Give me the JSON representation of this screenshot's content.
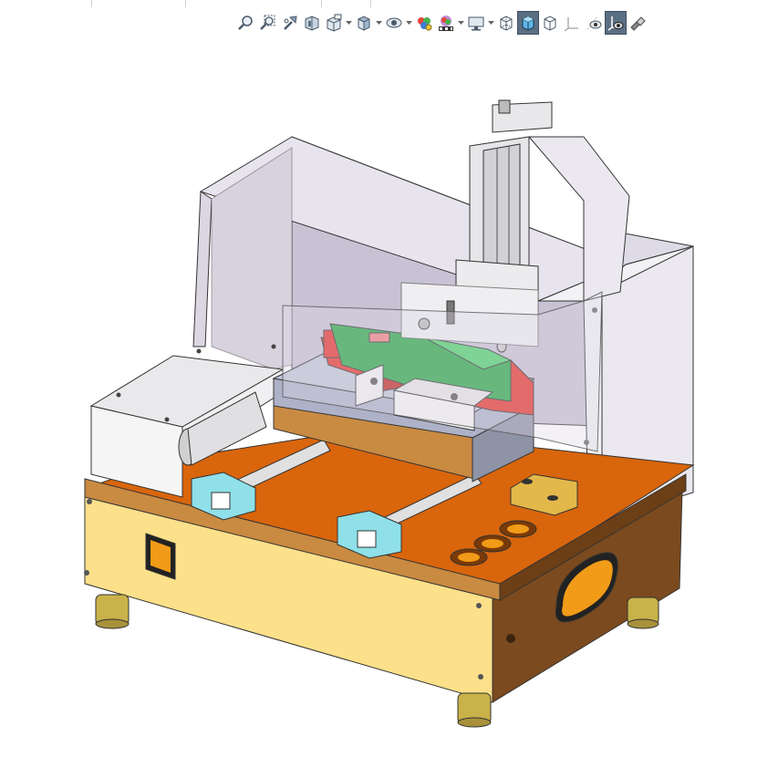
{
  "window": {
    "tabs": [
      "",
      "",
      "",
      ""
    ]
  },
  "toolbar": {
    "buttons": [
      {
        "id": "zoom-to-fit",
        "icon": "zoom-to-fit-icon",
        "dropdown": false
      },
      {
        "id": "zoom-to-area",
        "icon": "zoom-area-icon",
        "dropdown": false
      },
      {
        "id": "previous-view",
        "icon": "previous-view-icon",
        "dropdown": false
      },
      {
        "id": "section-view",
        "icon": "section-view-icon",
        "dropdown": false
      },
      {
        "id": "dynamic-annotation",
        "icon": "dynamic-annotation-icon",
        "dropdown": true
      },
      {
        "id": "view-orientation",
        "icon": "view-orientation-icon",
        "dropdown": true
      },
      {
        "id": "display-style",
        "icon": "display-style-icon",
        "dropdown": true
      },
      {
        "id": "hide-show",
        "icon": "hide-show-icon",
        "dropdown": false
      },
      {
        "id": "edit-appearance",
        "icon": "edit-appearance-icon",
        "dropdown": false
      },
      {
        "id": "apply-scene",
        "icon": "apply-scene-icon",
        "dropdown": true
      },
      {
        "id": "view-settings",
        "icon": "view-settings-icon",
        "dropdown": true
      },
      {
        "id": "wireframe",
        "icon": "wireframe-cube-icon",
        "dropdown": false
      },
      {
        "id": "shaded",
        "icon": "shaded-cube-icon",
        "dropdown": false,
        "active": true
      },
      {
        "id": "hidden-lines",
        "icon": "hidden-lines-cube-icon",
        "dropdown": false
      },
      {
        "id": "view-planes",
        "icon": "view-planes-icon",
        "dropdown": false
      },
      {
        "id": "view-sketch",
        "icon": "view-sketch-eye-icon",
        "dropdown": false
      },
      {
        "id": "view-origins",
        "icon": "view-origins-icon",
        "dropdown": false,
        "active": true
      },
      {
        "id": "view-lights",
        "icon": "view-lights-icon",
        "dropdown": false
      }
    ]
  },
  "colors": {
    "toolbar_active": "#5b6f82",
    "base_yellow": "#fde08a",
    "base_top_orange": "#d9650c",
    "base_brown": "#7b4a1e",
    "cover_purple": "#c7bfd0",
    "cover_white": "#f4f4f4",
    "fixture_red": "#e8322a",
    "fixture_green": "#2aa845",
    "plate_grey": "#aeb2c8",
    "rail_cyan": "#8fe0e8",
    "feet_olive": "#c9b24a"
  }
}
